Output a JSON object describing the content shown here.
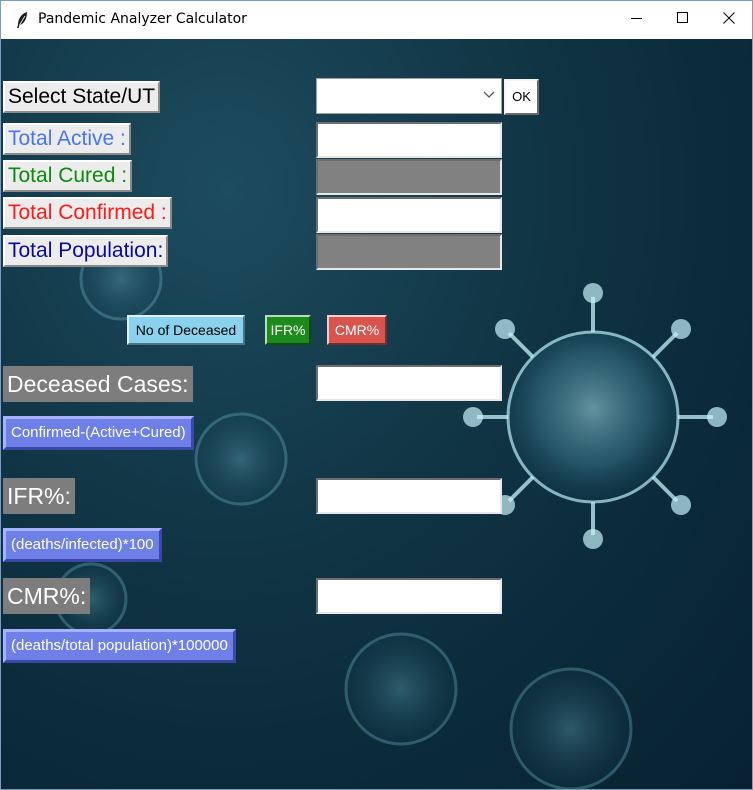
{
  "window": {
    "title": "Pandemic Analyzer Calculator",
    "icons": {
      "app": "feather-icon",
      "minimize": "minimize-icon",
      "maximize": "maximize-icon",
      "close": "close-icon"
    }
  },
  "state_select": {
    "label": "Select State/UT",
    "value": "",
    "ok_label": "OK"
  },
  "stats": {
    "active": {
      "label": "Total Active :",
      "value": "",
      "color": "#4a74f0"
    },
    "cured": {
      "label": "Total Cured :",
      "value": "",
      "color": "#0b8a0b"
    },
    "confirmed": {
      "label": "Total Confirmed :",
      "value": "",
      "color": "#ff1a1a"
    },
    "population": {
      "label": "Total Population:",
      "value": "",
      "color": "#0a0a9a"
    }
  },
  "actions": {
    "deceased_label": "No of Deceased",
    "ifr_label": "IFR%",
    "cmr_label": "CMR%",
    "colors": {
      "deceased": "#89d1ec",
      "ifr": "#1c8b1c",
      "cmr": "#d9534f"
    }
  },
  "results": {
    "deceased": {
      "label": "Deceased Cases:",
      "value": "",
      "formula": "Confirmed-(Active+Cured)"
    },
    "ifr": {
      "label": "IFR%:",
      "value": "",
      "formula": "(deaths/infected)*100"
    },
    "cmr": {
      "label": "CMR%:",
      "value": "",
      "formula": "(deaths/total population)*100000"
    }
  }
}
